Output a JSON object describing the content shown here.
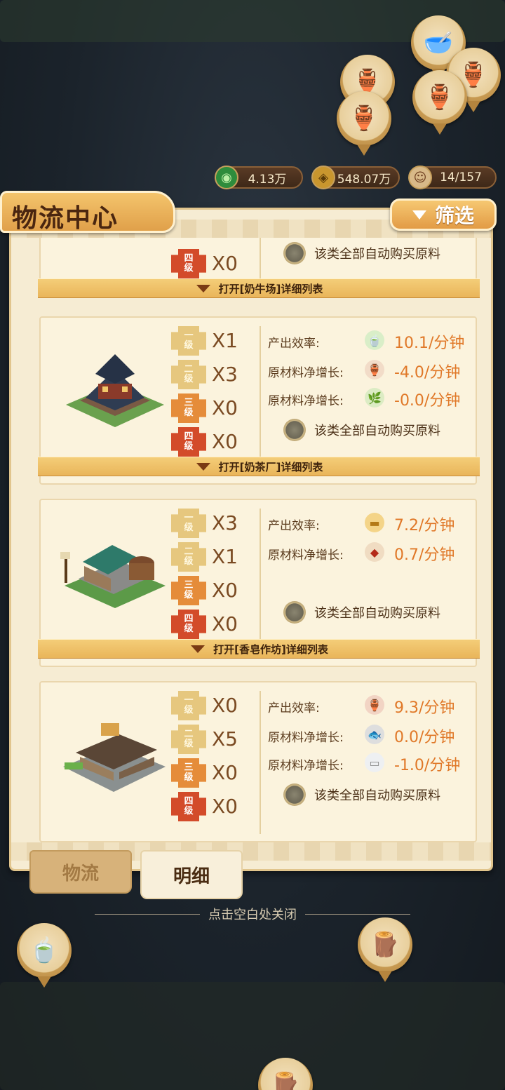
{
  "resources": [
    {
      "icon": "jade-coin-icon",
      "value": "4.13万"
    },
    {
      "icon": "copper-coin-icon",
      "value": "548.07万"
    },
    {
      "icon": "population-icon",
      "value": "14/157"
    }
  ],
  "panel": {
    "title": "物流中心",
    "filter_label": "筛选"
  },
  "level_labels": [
    "一级",
    "二级",
    "三级",
    "四级"
  ],
  "auto_buy_label": "该类全部自动购买原料",
  "stat_labels": {
    "output": "产出效率:",
    "material": "原材料净增长:"
  },
  "cards": [
    {
      "name": "奶牛场",
      "partial": true,
      "levels": [
        "",
        "",
        "",
        "X0"
      ],
      "open_label": "打开[奶牛场]详细列表"
    },
    {
      "name": "奶茶厂",
      "levels": [
        "X1",
        "X3",
        "X0",
        "X0"
      ],
      "stats": [
        {
          "label": "产出效率:",
          "icon": "milk-tea-icon",
          "value": "10.1/分钟"
        },
        {
          "label": "原材料净增长:",
          "icon": "wine-jar-icon",
          "value": "-4.0/分钟"
        },
        {
          "label": "原材料净增长:",
          "icon": "tea-leaves-icon",
          "value": "-0.0/分钟"
        }
      ],
      "open_label": "打开[奶茶厂]详细列表"
    },
    {
      "name": "香皂作坊",
      "levels": [
        "X3",
        "X1",
        "X0",
        "X0"
      ],
      "stats": [
        {
          "label": "产出效率:",
          "icon": "soap-icon",
          "value": "7.2/分钟"
        },
        {
          "label": "原材料净增长:",
          "icon": "sack-icon",
          "value": "0.7/分钟"
        }
      ],
      "open_label": "打开[香皂作坊]详细列表"
    },
    {
      "name": "酒坊",
      "levels": [
        "X0",
        "X5",
        "X0",
        "X0"
      ],
      "stats": [
        {
          "label": "产出效率:",
          "icon": "wine-jar-icon",
          "value": "9.3/分钟"
        },
        {
          "label": "原材料净增长:",
          "icon": "fish-icon",
          "value": "0.0/分钟"
        },
        {
          "label": "原材料净增长:",
          "icon": "paper-icon",
          "value": "-1.0/分钟"
        }
      ]
    }
  ],
  "tabs": {
    "logistics": "物流",
    "detail": "明细"
  },
  "close_hint": "点击空白处关闭"
}
